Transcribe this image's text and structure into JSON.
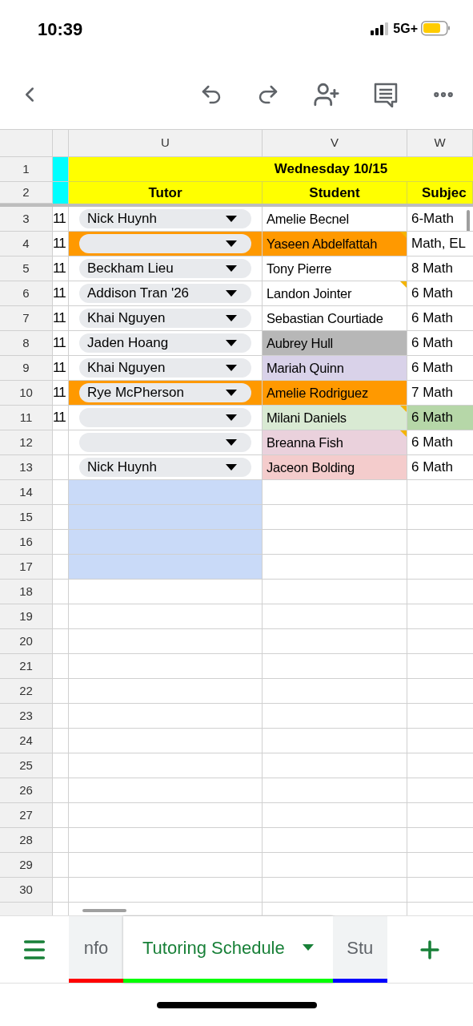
{
  "status_bar": {
    "time": "10:39",
    "network": "5G+"
  },
  "sheet": {
    "columns": [
      {
        "label": "U"
      },
      {
        "label": "V"
      },
      {
        "label": "W"
      }
    ],
    "title_row": {
      "number": "1",
      "text": "Wednesday 10/15"
    },
    "header_row": {
      "number": "2",
      "cells": [
        "Tutor",
        "Student",
        "Subjec"
      ]
    },
    "rows": [
      {
        "number": "3",
        "selected": false,
        "col_t": "11",
        "tutor": {
          "value": "Nick Huynh"
        },
        "student": {
          "value": "Amelie Becnel",
          "note": false
        },
        "subject": {
          "value": "6-Math"
        }
      },
      {
        "number": "4",
        "selected": false,
        "col_t": "11",
        "tutor": {
          "color": "#ff9900"
        },
        "student": {
          "value": "Yaseen Abdelfattah",
          "color": "#ff9900",
          "note": true
        },
        "subject": {
          "value": "Math, EL"
        }
      },
      {
        "number": "5",
        "selected": false,
        "col_t": "11",
        "tutor": {
          "value": "Beckham Lieu"
        },
        "student": {
          "value": "Tony Pierre",
          "note": false
        },
        "subject": {
          "value": "8 Math"
        }
      },
      {
        "number": "6",
        "selected": false,
        "col_t": "11",
        "tutor": {
          "value": "Addison Tran '26"
        },
        "student": {
          "value": "Landon Jointer",
          "note": true
        },
        "subject": {
          "value": "6 Math"
        }
      },
      {
        "number": "7",
        "selected": false,
        "col_t": "11",
        "tutor": {
          "value": "Khai Nguyen"
        },
        "student": {
          "value": "Sebastian Courtiade",
          "note": false
        },
        "subject": {
          "value": "6 Math"
        }
      },
      {
        "number": "8",
        "selected": false,
        "col_t": "11",
        "tutor": {
          "value": "Jaden Hoang"
        },
        "student": {
          "value": "Aubrey Hull",
          "color": "#b7b7b7",
          "note": false
        },
        "subject": {
          "value": "6 Math"
        }
      },
      {
        "number": "9",
        "selected": false,
        "col_t": "11",
        "tutor": {
          "value": "Khai Nguyen"
        },
        "student": {
          "value": "Mariah Quinn",
          "color": "#d9d2e9",
          "note": false
        },
        "subject": {
          "value": "6 Math"
        }
      },
      {
        "number": "10",
        "selected": false,
        "col_t": "11",
        "tutor": {
          "value": "Rye McPherson",
          "color": "#ff9900"
        },
        "student": {
          "value": "Amelie Rodriguez",
          "color": "#ff9900",
          "note": false
        },
        "subject": {
          "value": "7 Math"
        }
      },
      {
        "number": "11",
        "selected": false,
        "col_t": "11",
        "tutor": {},
        "student": {
          "value": "Milani Daniels",
          "color": "#d9ead3",
          "note": true
        },
        "subject": {
          "value": "6 Math",
          "color": "#b6d7a8"
        }
      },
      {
        "number": "12",
        "selected": false,
        "tutor": {},
        "student": {
          "value": "Breanna Fish",
          "color": "#ead1dc",
          "note": true
        },
        "subject": {
          "value": "6 Math"
        }
      },
      {
        "number": "13",
        "selected": false,
        "tutor": {
          "value": "Nick Huynh"
        },
        "student": {
          "value": "Jaceon Bolding",
          "color": "#f4cccc",
          "note": false
        },
        "subject": {
          "value": "6 Math"
        }
      },
      {
        "number": "14",
        "selected": true
      },
      {
        "number": "15",
        "selected": true
      },
      {
        "number": "16",
        "selected": true
      },
      {
        "number": "17",
        "selected": true
      },
      {
        "number": "18",
        "selected": false
      },
      {
        "number": "19",
        "selected": false
      },
      {
        "number": "20",
        "selected": false
      },
      {
        "number": "21",
        "selected": false
      },
      {
        "number": "22",
        "selected": false
      },
      {
        "number": "23",
        "selected": false
      },
      {
        "number": "24",
        "selected": false
      },
      {
        "number": "25",
        "selected": false
      },
      {
        "number": "26",
        "selected": false
      },
      {
        "number": "27",
        "selected": false
      },
      {
        "number": "28",
        "selected": false
      },
      {
        "number": "29",
        "selected": false
      },
      {
        "number": "30",
        "selected": false
      }
    ]
  },
  "sheet_tabs": [
    {
      "label": "nfo",
      "selected": false,
      "color": "#ff0000"
    },
    {
      "label": "Tutoring Schedule",
      "selected": true,
      "color": "#00ff00"
    },
    {
      "label": "Stu",
      "selected": false,
      "color": "#0000ff"
    }
  ]
}
